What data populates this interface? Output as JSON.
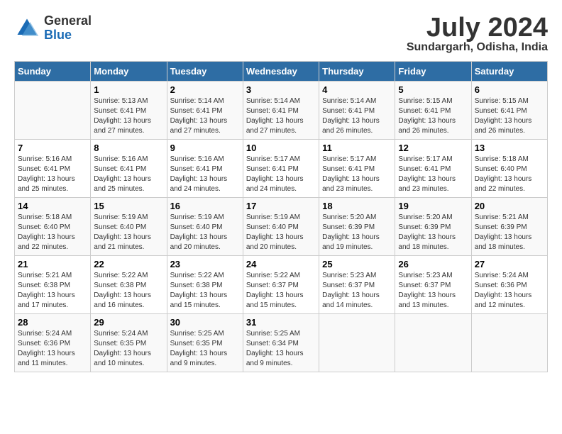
{
  "header": {
    "logo_general": "General",
    "logo_blue": "Blue",
    "month_title": "July 2024",
    "location": "Sundargarh, Odisha, India"
  },
  "days_of_week": [
    "Sunday",
    "Monday",
    "Tuesday",
    "Wednesday",
    "Thursday",
    "Friday",
    "Saturday"
  ],
  "weeks": [
    [
      {
        "day": "",
        "info": ""
      },
      {
        "day": "1",
        "info": "Sunrise: 5:13 AM\nSunset: 6:41 PM\nDaylight: 13 hours\nand 27 minutes."
      },
      {
        "day": "2",
        "info": "Sunrise: 5:14 AM\nSunset: 6:41 PM\nDaylight: 13 hours\nand 27 minutes."
      },
      {
        "day": "3",
        "info": "Sunrise: 5:14 AM\nSunset: 6:41 PM\nDaylight: 13 hours\nand 27 minutes."
      },
      {
        "day": "4",
        "info": "Sunrise: 5:14 AM\nSunset: 6:41 PM\nDaylight: 13 hours\nand 26 minutes."
      },
      {
        "day": "5",
        "info": "Sunrise: 5:15 AM\nSunset: 6:41 PM\nDaylight: 13 hours\nand 26 minutes."
      },
      {
        "day": "6",
        "info": "Sunrise: 5:15 AM\nSunset: 6:41 PM\nDaylight: 13 hours\nand 26 minutes."
      }
    ],
    [
      {
        "day": "7",
        "info": "Sunrise: 5:16 AM\nSunset: 6:41 PM\nDaylight: 13 hours\nand 25 minutes."
      },
      {
        "day": "8",
        "info": "Sunrise: 5:16 AM\nSunset: 6:41 PM\nDaylight: 13 hours\nand 25 minutes."
      },
      {
        "day": "9",
        "info": "Sunrise: 5:16 AM\nSunset: 6:41 PM\nDaylight: 13 hours\nand 24 minutes."
      },
      {
        "day": "10",
        "info": "Sunrise: 5:17 AM\nSunset: 6:41 PM\nDaylight: 13 hours\nand 24 minutes."
      },
      {
        "day": "11",
        "info": "Sunrise: 5:17 AM\nSunset: 6:41 PM\nDaylight: 13 hours\nand 23 minutes."
      },
      {
        "day": "12",
        "info": "Sunrise: 5:17 AM\nSunset: 6:41 PM\nDaylight: 13 hours\nand 23 minutes."
      },
      {
        "day": "13",
        "info": "Sunrise: 5:18 AM\nSunset: 6:40 PM\nDaylight: 13 hours\nand 22 minutes."
      }
    ],
    [
      {
        "day": "14",
        "info": "Sunrise: 5:18 AM\nSunset: 6:40 PM\nDaylight: 13 hours\nand 22 minutes."
      },
      {
        "day": "15",
        "info": "Sunrise: 5:19 AM\nSunset: 6:40 PM\nDaylight: 13 hours\nand 21 minutes."
      },
      {
        "day": "16",
        "info": "Sunrise: 5:19 AM\nSunset: 6:40 PM\nDaylight: 13 hours\nand 20 minutes."
      },
      {
        "day": "17",
        "info": "Sunrise: 5:19 AM\nSunset: 6:40 PM\nDaylight: 13 hours\nand 20 minutes."
      },
      {
        "day": "18",
        "info": "Sunrise: 5:20 AM\nSunset: 6:39 PM\nDaylight: 13 hours\nand 19 minutes."
      },
      {
        "day": "19",
        "info": "Sunrise: 5:20 AM\nSunset: 6:39 PM\nDaylight: 13 hours\nand 18 minutes."
      },
      {
        "day": "20",
        "info": "Sunrise: 5:21 AM\nSunset: 6:39 PM\nDaylight: 13 hours\nand 18 minutes."
      }
    ],
    [
      {
        "day": "21",
        "info": "Sunrise: 5:21 AM\nSunset: 6:38 PM\nDaylight: 13 hours\nand 17 minutes."
      },
      {
        "day": "22",
        "info": "Sunrise: 5:22 AM\nSunset: 6:38 PM\nDaylight: 13 hours\nand 16 minutes."
      },
      {
        "day": "23",
        "info": "Sunrise: 5:22 AM\nSunset: 6:38 PM\nDaylight: 13 hours\nand 15 minutes."
      },
      {
        "day": "24",
        "info": "Sunrise: 5:22 AM\nSunset: 6:37 PM\nDaylight: 13 hours\nand 15 minutes."
      },
      {
        "day": "25",
        "info": "Sunrise: 5:23 AM\nSunset: 6:37 PM\nDaylight: 13 hours\nand 14 minutes."
      },
      {
        "day": "26",
        "info": "Sunrise: 5:23 AM\nSunset: 6:37 PM\nDaylight: 13 hours\nand 13 minutes."
      },
      {
        "day": "27",
        "info": "Sunrise: 5:24 AM\nSunset: 6:36 PM\nDaylight: 13 hours\nand 12 minutes."
      }
    ],
    [
      {
        "day": "28",
        "info": "Sunrise: 5:24 AM\nSunset: 6:36 PM\nDaylight: 13 hours\nand 11 minutes."
      },
      {
        "day": "29",
        "info": "Sunrise: 5:24 AM\nSunset: 6:35 PM\nDaylight: 13 hours\nand 10 minutes."
      },
      {
        "day": "30",
        "info": "Sunrise: 5:25 AM\nSunset: 6:35 PM\nDaylight: 13 hours\nand 9 minutes."
      },
      {
        "day": "31",
        "info": "Sunrise: 5:25 AM\nSunset: 6:34 PM\nDaylight: 13 hours\nand 9 minutes."
      },
      {
        "day": "",
        "info": ""
      },
      {
        "day": "",
        "info": ""
      },
      {
        "day": "",
        "info": ""
      }
    ]
  ]
}
